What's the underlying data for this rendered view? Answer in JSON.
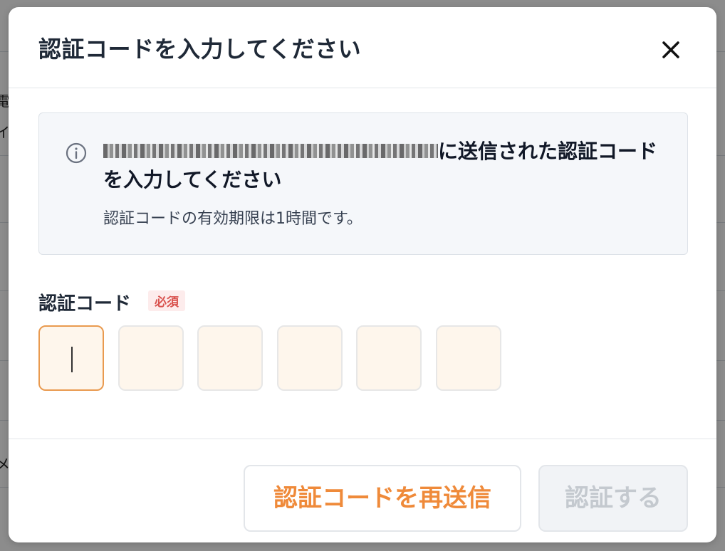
{
  "background": {
    "glyphs": [
      "電",
      "イ",
      "メ"
    ]
  },
  "modal": {
    "title": "認証コードを入力してください",
    "close_icon": "close-icon"
  },
  "info": {
    "icon": "info-circle-icon",
    "message_suffix": "に送信された認証コードを入力してください",
    "sub_message": "認証コードの有効期限は1時間です。"
  },
  "field": {
    "label": "認証コード",
    "required_badge": "必須",
    "digit_count": 6,
    "digits": [
      "",
      "",
      "",
      "",
      "",
      ""
    ]
  },
  "footer": {
    "resend_label": "認証コードを再送信",
    "verify_label": "認証する"
  },
  "colors": {
    "accent": "#ef8a3a",
    "required": "#d9534f",
    "input_bg": "#fef6ec",
    "active_border": "#e99a4f",
    "disabled_text": "#c4c9cf"
  }
}
